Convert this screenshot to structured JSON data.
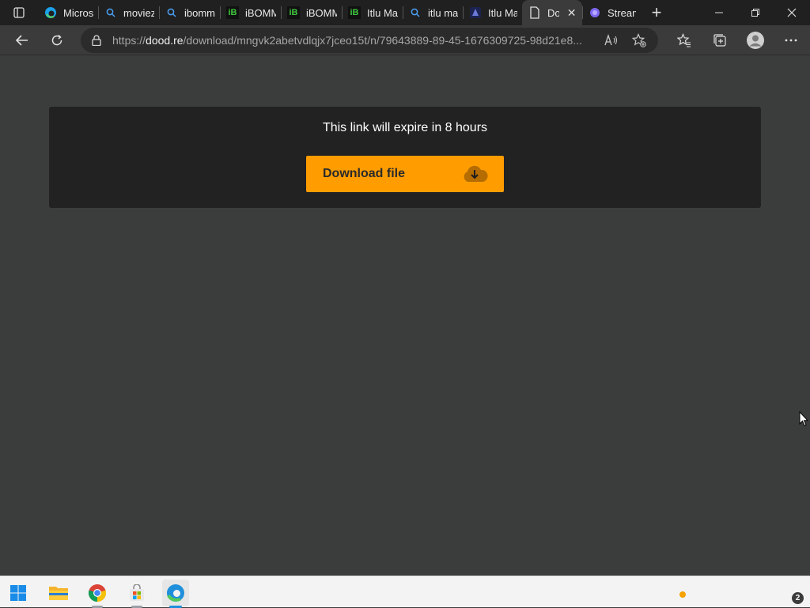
{
  "browser": {
    "tabs": [
      {
        "title": "Microsoft",
        "favicon": "edge-icon"
      },
      {
        "title": "moviez",
        "favicon": "search-icon"
      },
      {
        "title": "ibomma",
        "favicon": "search-icon"
      },
      {
        "title": "iBOMMA",
        "favicon": "ibomma-icon",
        "favicon_text": "iB"
      },
      {
        "title": "iBOMMA",
        "favicon": "ibomma-icon",
        "favicon_text": "iB"
      },
      {
        "title": "Itlu Ma",
        "favicon": "ibomma-icon",
        "favicon_text": "iB"
      },
      {
        "title": "itlu ma",
        "favicon": "search-icon"
      },
      {
        "title": "Itlu Ma",
        "favicon": "site-icon"
      },
      {
        "title": "Do",
        "favicon": "page-icon",
        "active": true
      },
      {
        "title": "Stream",
        "favicon": "stream-icon"
      }
    ],
    "address": {
      "prefix": "https://",
      "domain": "dood.re",
      "path": "/download/mngvk2abetvdlqjx7jceo15t/n/79643889-89-45-1676309725-98d21e8..."
    }
  },
  "page": {
    "expire_text": "This link will expire in 8 hours",
    "download_label": "Download file"
  },
  "colors": {
    "accent": "#ff9d00",
    "page_bg": "#3b3d3d",
    "card_bg": "#222222"
  },
  "taskbar": {
    "apps": [
      "start-icon",
      "file-explorer-icon",
      "chrome-icon",
      "store-icon",
      "edge-icon"
    ],
    "notification_count": "2"
  }
}
